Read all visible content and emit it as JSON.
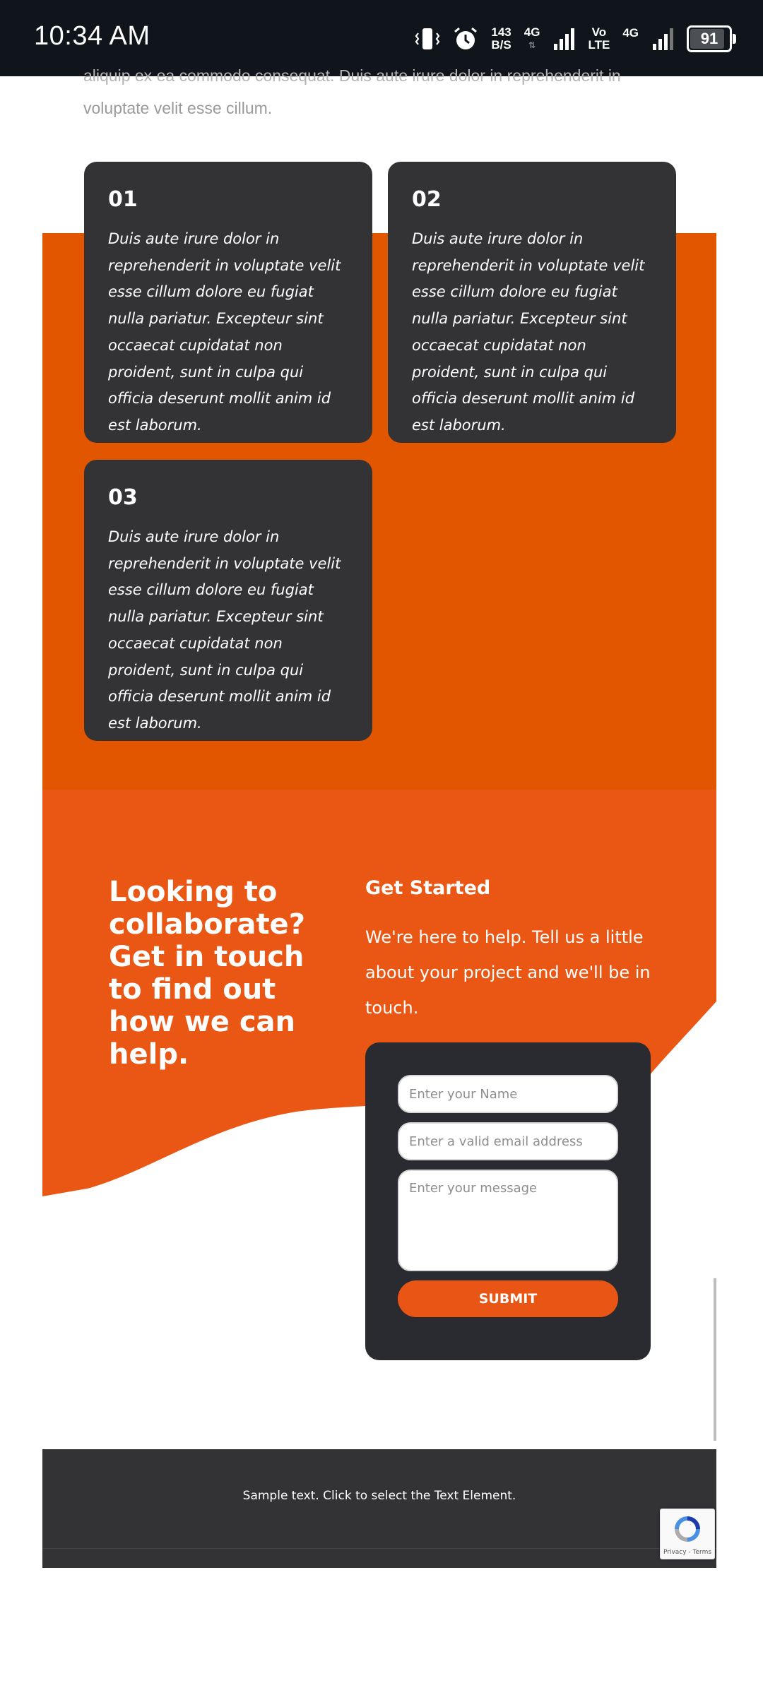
{
  "status_bar": {
    "time": "10:34 AM",
    "net_speed_value": "143",
    "net_speed_unit": "B/S",
    "network_1": "4G",
    "volte_top": "Vo",
    "volte_bottom": "LTE",
    "network_2": "4G",
    "battery": "91"
  },
  "intro": {
    "cut_text": "aliquip ex ea commodo consequat. Duis aute irure dolor in reprehenderit in",
    "text": "voluptate velit esse cillum."
  },
  "cards": [
    {
      "number": "01",
      "text": "Duis aute irure dolor in reprehenderit in voluptate velit esse cillum dolore eu fugiat nulla pariatur. Excepteur sint occaecat cupidatat non proident, sunt in culpa qui officia deserunt mollit anim id est laborum."
    },
    {
      "number": "02",
      "text": "Duis aute irure dolor in reprehenderit in voluptate velit esse cillum dolore eu fugiat nulla pariatur. Excepteur sint occaecat cupidatat non proident, sunt in culpa qui officia deserunt mollit anim id est laborum."
    },
    {
      "number": "03",
      "text": "Duis aute irure dolor in reprehenderit in voluptate velit esse cillum dolore eu fugiat nulla pariatur. Excepteur sint occaecat cupidatat non proident, sunt in culpa qui officia deserunt mollit anim id est laborum."
    }
  ],
  "contact": {
    "heading": "Looking to collaborate? Get in touch to find out how we can help.",
    "get_started_title": "Get Started",
    "get_started_text": "We're here to help. Tell us a little about your project and we'll be in touch.",
    "form": {
      "name_placeholder": "Enter your Name",
      "email_placeholder": "Enter a valid email address",
      "message_placeholder": "Enter your message",
      "submit_label": "SUBMIT"
    }
  },
  "footer": {
    "text": "Sample text. Click to select the Text Element."
  },
  "recaptcha": {
    "links": "Privacy - Terms"
  },
  "colors": {
    "status_bar_bg": "#10141b",
    "orange_dark": "#e25600",
    "orange_light": "#ea5715",
    "card_bg": "#333335",
    "form_bg": "#2a2b30",
    "submit_bg": "#e85514",
    "footer_bg": "#333336"
  },
  "icons": [
    "vibrate-icon",
    "alarm-icon",
    "signal-icon",
    "battery-icon",
    "recaptcha-icon"
  ]
}
